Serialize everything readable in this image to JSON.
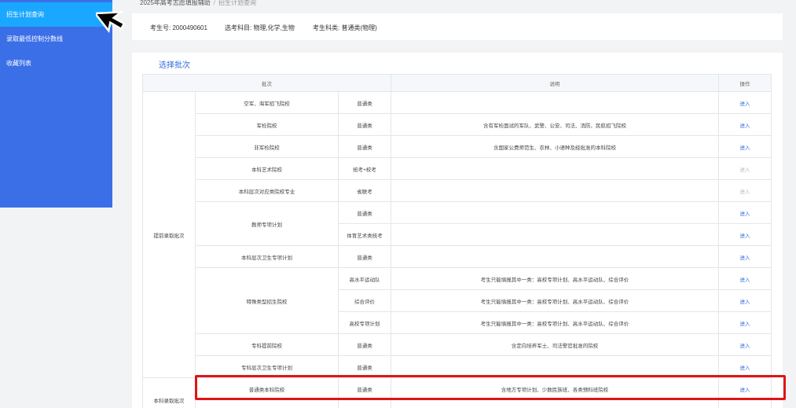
{
  "sidebar": {
    "items": [
      {
        "label": "招生计划查询",
        "active": true
      },
      {
        "label": "录取最低控制分数线",
        "active": false
      },
      {
        "label": "收藏列表",
        "active": false
      }
    ]
  },
  "breadcrumb": {
    "root": "2025年高考志愿填报辅助",
    "sep": "/",
    "current": "招生计划查询"
  },
  "info": {
    "exam_no": "考生号: 2000490601",
    "subjects": "选考科目: 物理,化学,生物",
    "category": "考生科类: 普通类(物理)"
  },
  "section_title": "选择批次",
  "table": {
    "headers": {
      "batch": "批次",
      "desc": "说明",
      "op": "操作"
    },
    "group_labels": {
      "early": "提前录取批次",
      "undergrad": "本科录取批次"
    },
    "rows": [
      {
        "name": "空军、海军招飞院校",
        "type": "普通类",
        "desc": "",
        "op": "进入",
        "enabled": true
      },
      {
        "name": "军检院校",
        "type": "普通类",
        "desc": "含有军检面试的军队、武警、公安、司法、消防、民航招飞院校",
        "op": "进入",
        "enabled": true
      },
      {
        "name": "非军检院校",
        "type": "普通类",
        "desc": "含国家公费师范生、农林、小语种及经批准的本科院校",
        "op": "进入",
        "enabled": true
      },
      {
        "name": "本科艺术院校",
        "type": "统考+校考",
        "desc": "",
        "op": "进入",
        "enabled": false
      },
      {
        "name": "本科层次对应类院校专业",
        "type": "省联考",
        "desc": "",
        "op": "进入",
        "enabled": false
      },
      {
        "name": "教师专项计划",
        "type": "普通类",
        "desc": "",
        "op": "进入",
        "enabled": true
      },
      {
        "name": "",
        "type": "体育艺术类统考",
        "desc": "",
        "op": "进入",
        "enabled": true
      },
      {
        "name": "本科层次卫生专项计划",
        "type": "普通类",
        "desc": "",
        "op": "进入",
        "enabled": true
      },
      {
        "name": "特殊类型招生院校",
        "type": "高水平运动队",
        "desc": "考生只能填报其中一类：高校专项计划、高水平运动队、综合评价",
        "op": "进入",
        "enabled": true
      },
      {
        "name": "",
        "type": "综合评价",
        "desc": "考生只能填报其中一类：高校专项计划、高水平运动队、综合评价",
        "op": "进入",
        "enabled": true
      },
      {
        "name": "",
        "type": "高校专项计划",
        "desc": "考生只能填报其中一类：高校专项计划、高水平运动队、综合评价",
        "op": "进入",
        "enabled": true
      },
      {
        "name": "专科提前院校",
        "type": "普通类",
        "desc": "含定向培养军士、司法警官批准的院校",
        "op": "进入",
        "enabled": true
      },
      {
        "name": "专科层次卫生专项计划",
        "type": "普通类",
        "desc": "",
        "op": "进入",
        "enabled": true
      },
      {
        "name": "普通类本科院校",
        "type": "普通类",
        "desc": "含地方专项计划、少数民族班、各类预科班院校",
        "op": "进入",
        "enabled": true
      }
    ]
  }
}
